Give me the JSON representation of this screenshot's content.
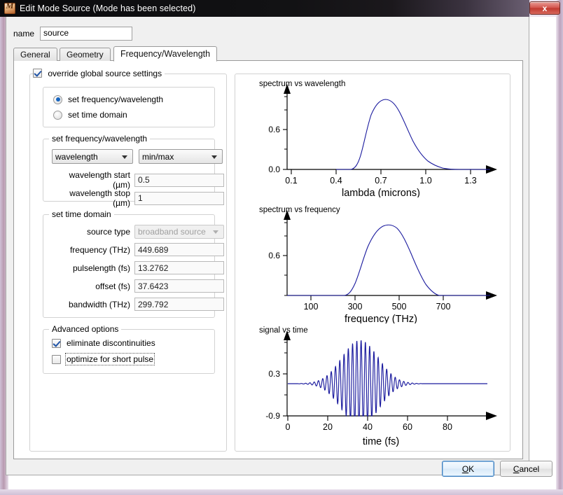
{
  "window": {
    "title": "Edit Mode Source (Mode has been selected)",
    "close_label": "x",
    "icon": "lumerical-app-icon"
  },
  "name_field": {
    "label": "name",
    "value": "source"
  },
  "tabs": [
    {
      "label": "General",
      "active": false
    },
    {
      "label": "Geometry",
      "active": false
    },
    {
      "label": "Frequency/Wavelength",
      "active": true
    }
  ],
  "override_group": {
    "legend": "override global source settings",
    "checked": true
  },
  "mode_radios": [
    {
      "label": "set frequency/wavelength",
      "selected": true
    },
    {
      "label": "set time domain",
      "selected": false
    }
  ],
  "freq_wav_group": {
    "legend": "set frequency/wavelength",
    "quantity_combo": "wavelength",
    "range_combo": "min/max",
    "fields": [
      {
        "label": "wavelength start (µm)",
        "value": "0.5"
      },
      {
        "label": "wavelength stop (µm)",
        "value": "1"
      }
    ]
  },
  "time_domain_group": {
    "legend": "set time domain",
    "source_type_label": "source type",
    "source_type_value": "broadband source",
    "fields": [
      {
        "label": "frequency (THz)",
        "value": "449.689"
      },
      {
        "label": "pulselength (fs)",
        "value": "13.2762"
      },
      {
        "label": "offset (fs)",
        "value": "37.6423"
      },
      {
        "label": "bandwidth (THz)",
        "value": "299.792"
      }
    ]
  },
  "advanced_group": {
    "legend": "Advanced options",
    "options": [
      {
        "label": "eliminate discontinuities",
        "checked": true,
        "focused": false
      },
      {
        "label": "optimize for short pulse",
        "checked": false,
        "focused": true
      }
    ]
  },
  "footer": {
    "ok_label": "OK",
    "cancel_label": "Cancel"
  },
  "colors": {
    "curve": "#1a1a9e",
    "axis": "#000000",
    "accent": "#1665c0"
  },
  "chart_data": [
    {
      "type": "line",
      "title": "spectrum vs wavelength",
      "xlabel": "lambda (microns)",
      "ylabel": "",
      "xticks": [
        0.1,
        0.4,
        0.7,
        1.0,
        1.3
      ],
      "xticklabels": [
        "0.1",
        "0.4",
        "0.7",
        "1.0",
        "1.3"
      ],
      "yticks": [
        0.0,
        0.6
      ],
      "yticklabels": [
        "0.0",
        "0.6"
      ],
      "xlim": [
        0.0,
        1.52
      ],
      "ylim": [
        0.0,
        1.05
      ],
      "grid": false,
      "x": [
        0.4,
        0.44,
        0.46,
        0.48,
        0.5,
        0.52,
        0.54,
        0.56,
        0.58,
        0.6,
        0.62,
        0.64,
        0.66,
        0.68,
        0.7,
        0.72,
        0.74,
        0.76,
        0.78,
        0.8,
        0.84,
        0.88,
        0.92,
        0.96,
        1.0,
        1.04,
        1.08,
        1.12,
        1.16,
        1.2
      ],
      "y": [
        0.0,
        0.0,
        0.01,
        0.05,
        0.16,
        0.33,
        0.52,
        0.68,
        0.8,
        0.88,
        0.92,
        0.945,
        0.95,
        0.945,
        0.925,
        0.89,
        0.845,
        0.79,
        0.73,
        0.665,
        0.53,
        0.4,
        0.285,
        0.19,
        0.115,
        0.062,
        0.03,
        0.012,
        0.004,
        0.0
      ]
    },
    {
      "type": "line",
      "title": "spectrum vs frequency",
      "xlabel": "frequency (THz)",
      "ylabel": "",
      "xticks": [
        100,
        300,
        500,
        700
      ],
      "xticklabels": [
        "100",
        "300",
        "500",
        "700"
      ],
      "yticks": [
        0.6
      ],
      "yticklabels": [
        "0.6"
      ],
      "xlim": [
        0,
        900
      ],
      "ylim": [
        0.0,
        1.05
      ],
      "grid": false,
      "x": [
        240,
        260,
        275,
        290,
        305,
        320,
        340,
        360,
        380,
        400,
        420,
        440,
        455,
        470,
        490,
        510,
        530,
        550,
        570,
        590,
        610,
        625,
        640,
        655,
        670
      ],
      "y": [
        0.0,
        0.01,
        0.03,
        0.07,
        0.14,
        0.23,
        0.38,
        0.55,
        0.7,
        0.83,
        0.92,
        0.955,
        0.96,
        0.95,
        0.91,
        0.84,
        0.74,
        0.62,
        0.47,
        0.33,
        0.19,
        0.11,
        0.055,
        0.02,
        0.0
      ]
    },
    {
      "type": "line",
      "title": "signal vs time",
      "xlabel": "time (fs)",
      "ylabel": "",
      "xticks": [
        0,
        20,
        40,
        60,
        80
      ],
      "xticklabels": [
        "0",
        "20",
        "40",
        "60",
        "80"
      ],
      "yticks": [
        0.3,
        -0.9
      ],
      "yticklabels": [
        "0.3",
        "-0.9"
      ],
      "xlim": [
        0,
        104
      ],
      "ylim": [
        -0.95,
        1.05
      ],
      "grid": false,
      "description": "Gaussian-enveloped oscillating pulse, carrier ~449.689 THz, centered near t = 38 fs, envelope decays to flat baseline after ~62 fs",
      "carrier_THz": 449.689,
      "pulselength_fs": 13.2762,
      "offset_fs": 37.6423,
      "baseline": 0.0
    }
  ]
}
